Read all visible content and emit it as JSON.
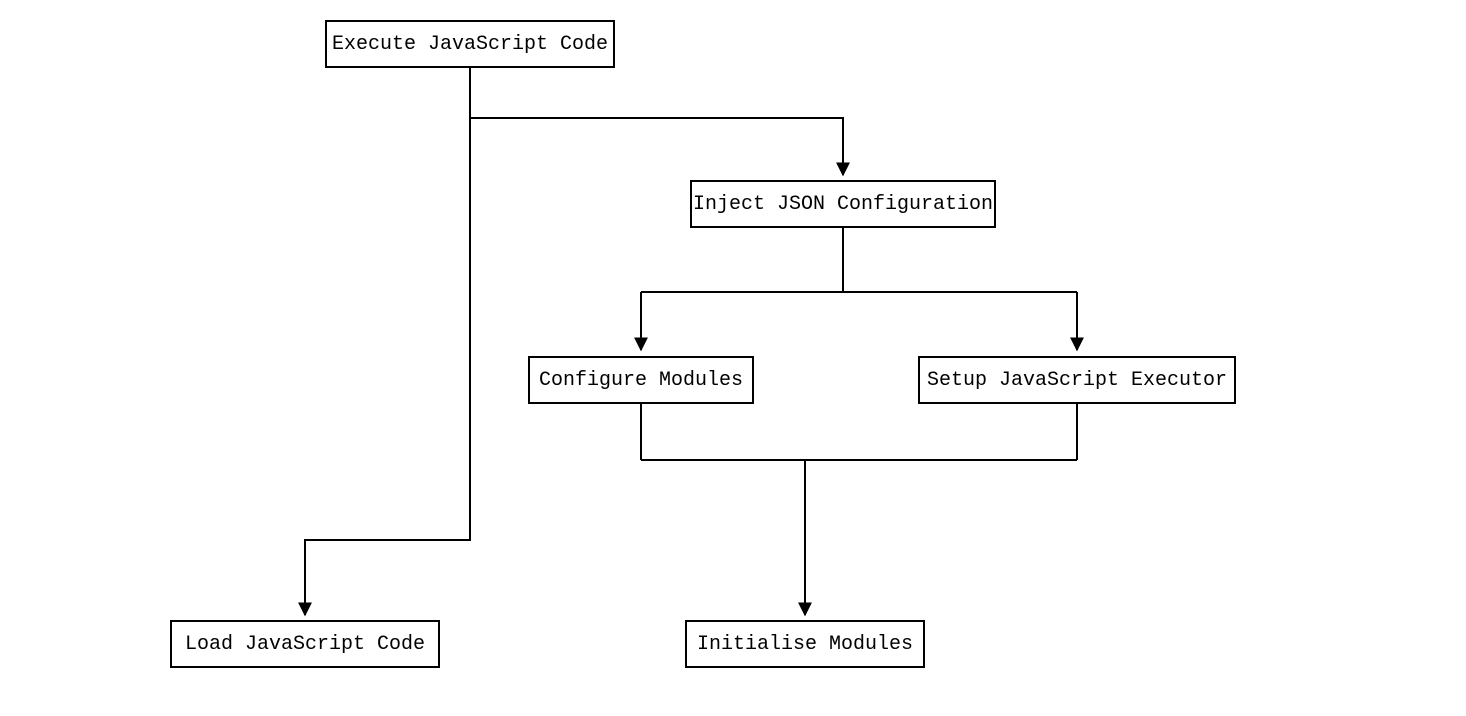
{
  "nodes": {
    "execute": {
      "label": "Execute JavaScript Code"
    },
    "inject": {
      "label": "Inject JSON Configuration"
    },
    "configure": {
      "label": "Configure Modules"
    },
    "setup": {
      "label": "Setup JavaScript Executor"
    },
    "load": {
      "label": "Load JavaScript Code"
    },
    "init": {
      "label": "Initialise Modules"
    }
  }
}
